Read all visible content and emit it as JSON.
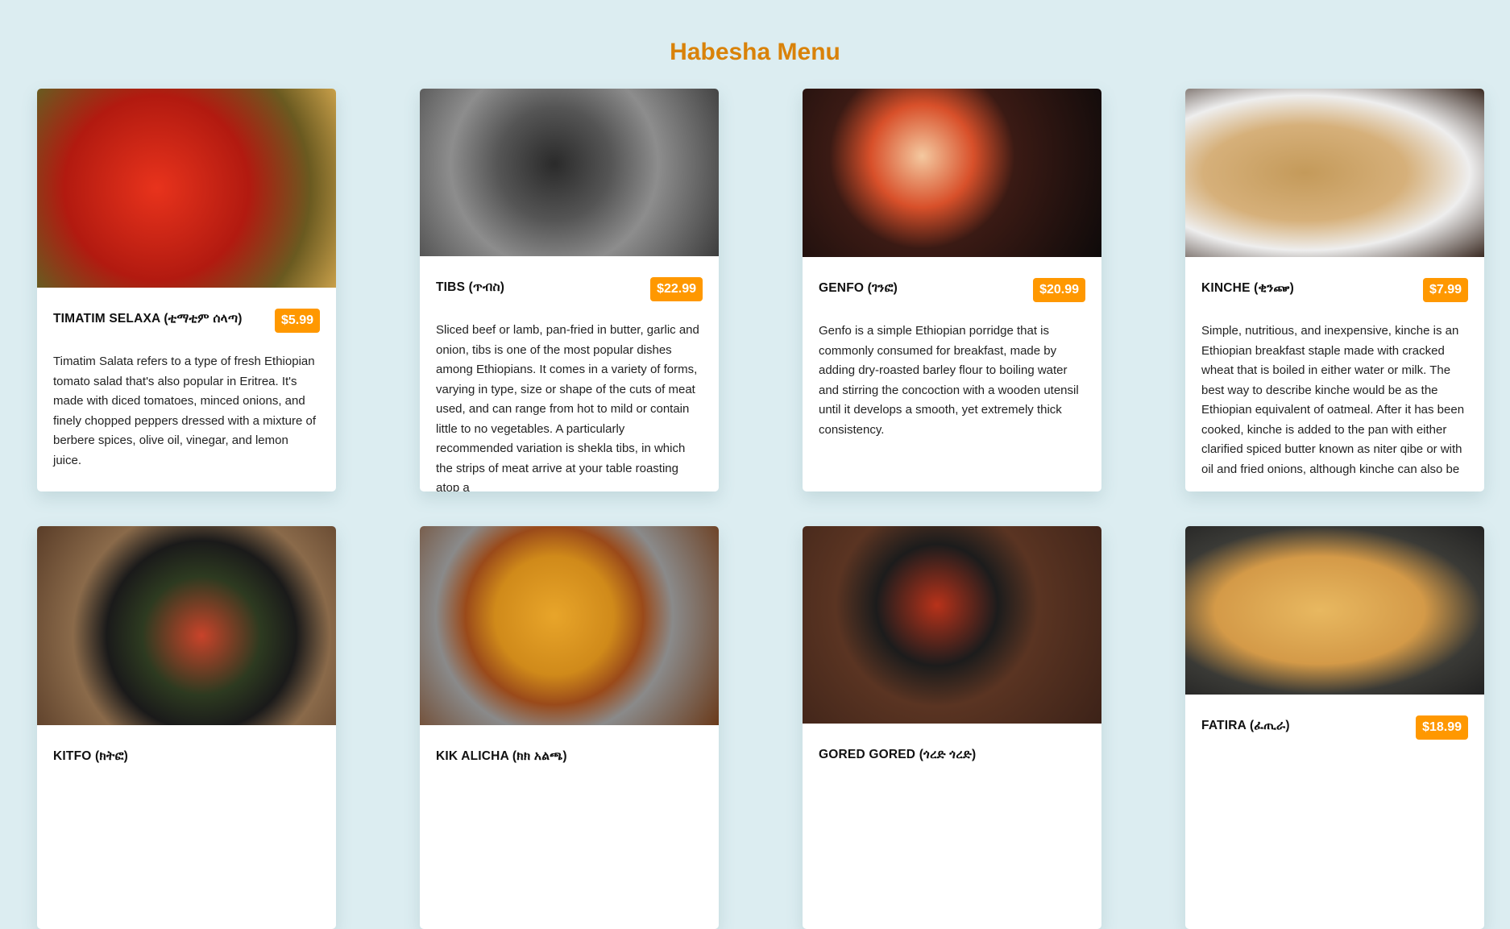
{
  "title": "Habesha Menu",
  "colors": {
    "background": "#dcedf1",
    "title": "#d98209",
    "price_badge": "#ff9800"
  },
  "items": [
    {
      "name": "TIMATIM SELAXA (ቲማቲም ሰላጣ)",
      "price": "$5.99",
      "description": "Timatim Salata refers to a type of fresh Ethiopian tomato salad that's also popular in Eritrea. It's made with diced tomatoes, minced onions, and finely chopped peppers dressed with a mixture of berbere spices, olive oil, vinegar, and lemon juice."
    },
    {
      "name": "TIBS (ጥብስ)",
      "price": "$22.99",
      "description": "Sliced beef or lamb, pan-fried in butter, garlic and onion, tibs is one of the most popular dishes among Ethiopians. It comes in a variety of forms, varying in type, size or shape of the cuts of meat used, and can range from hot to mild or contain little to no vegetables. A particularly recommended variation is shekla tibs, in which the strips of meat arrive at your table roasting atop a"
    },
    {
      "name": "GENFO (ገንፎ)",
      "price": "$20.99",
      "description": "Genfo is a simple Ethiopian porridge that is commonly consumed for breakfast, made by adding dry-roasted barley flour to boiling water and stirring the concoction with a wooden utensil until it develops a smooth, yet extremely thick consistency."
    },
    {
      "name": "KINCHE (ቂንጬ)",
      "price": "$7.99",
      "description": "Simple, nutritious, and inexpensive, kinche is an Ethiopian breakfast staple made with cracked wheat that is boiled in either water or milk. The best way to describe kinche would be as the Ethiopian equivalent of oatmeal. After it has been cooked, kinche is added to the pan with either clarified spiced butter known as niter qibe or with oil and fried onions, although kinche can also be"
    },
    {
      "name": "KITFO (ክትፎ)",
      "price": "",
      "description": ""
    },
    {
      "name": "KIK ALICHA (ክክ አልጫ)",
      "price": "",
      "description": ""
    },
    {
      "name": "GORED GORED (ጎረድ ጎረድ)",
      "price": "",
      "description": ""
    },
    {
      "name": "FATIRA (ፈጢራ)",
      "price": "$18.99",
      "description": ""
    }
  ]
}
